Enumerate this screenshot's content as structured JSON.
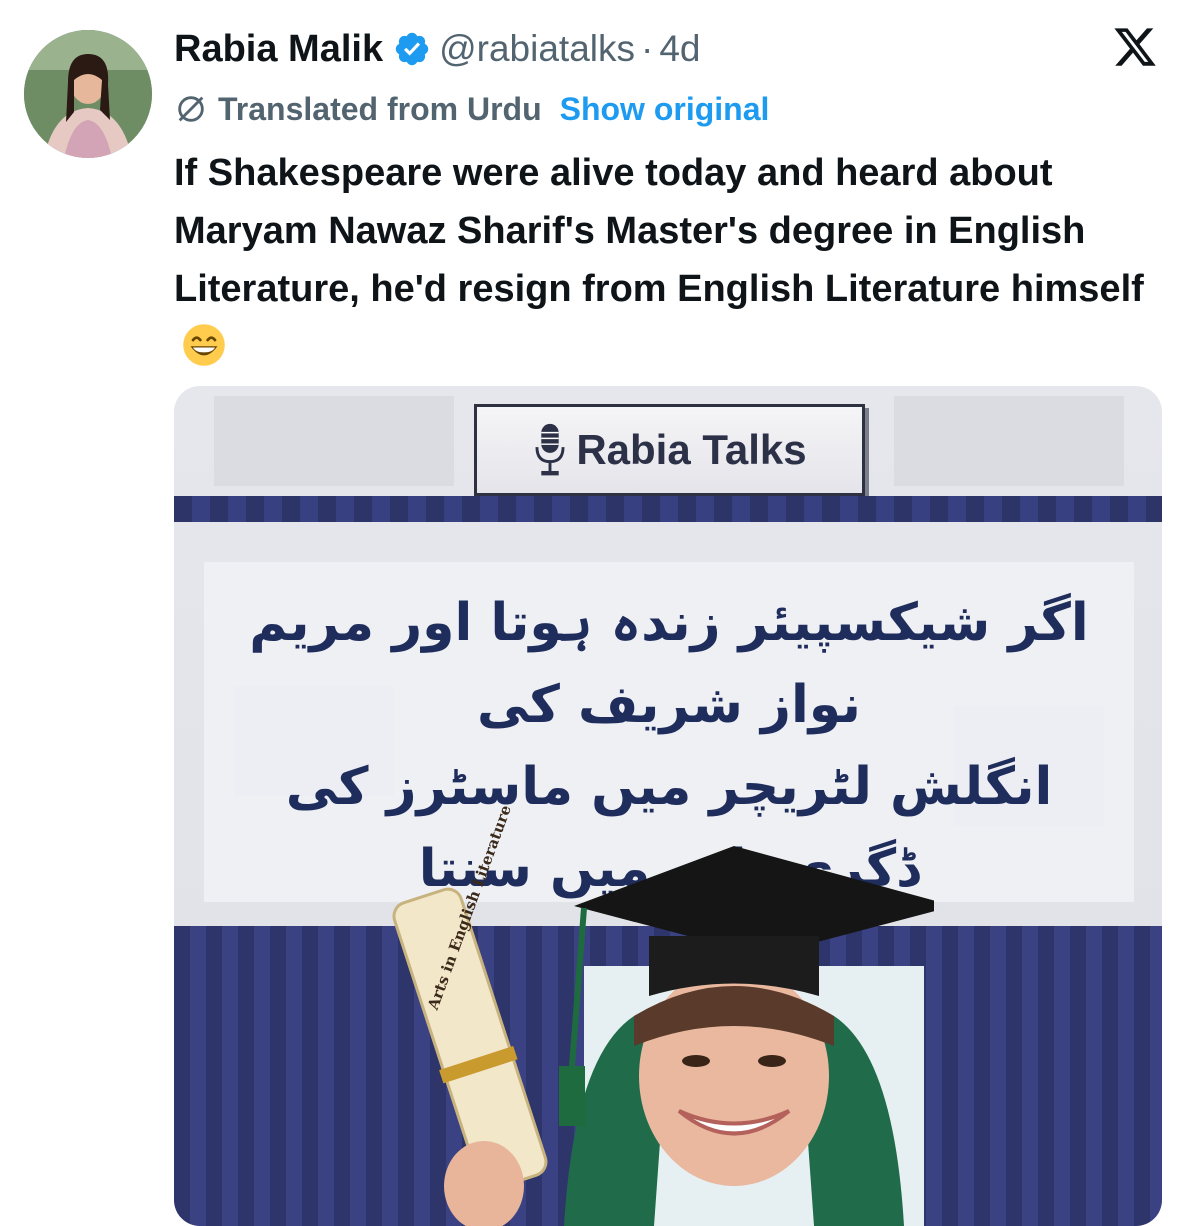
{
  "tweet": {
    "author_name": "Rabia Malik",
    "handle": "@rabiatalks",
    "separator": "·",
    "time": "4d",
    "translated_label": "Translated from Urdu",
    "show_original_label": "Show original",
    "text": "If Shakespeare were alive today and heard about Maryam Nawaz Sharif's Master's degree in English Literature, he'd resign from English Literature himself",
    "emoji": "grinning-face-with-smiling-eyes",
    "icons": {
      "verified": "verified-badge-icon",
      "platform": "x-logo-icon",
      "translate": "translate-icon"
    },
    "colors": {
      "link": "#1d9bf0",
      "secondary_text": "#536471",
      "verified": "#1d9bf0"
    }
  },
  "media": {
    "brand_text": "Rabia Talks",
    "urdu_quote": "اگر شیکسپیئر زندہ ہوتا اور مریم نواز شریف کی\nانگلش لٹریچر میں ماسٹرز کی ڈگری بارے میں سنتا\nتو وہ خود انگلش لٹریچر سے استعفیٰ دے دیتا!",
    "scroll_caption": "Arts in English Literature"
  }
}
